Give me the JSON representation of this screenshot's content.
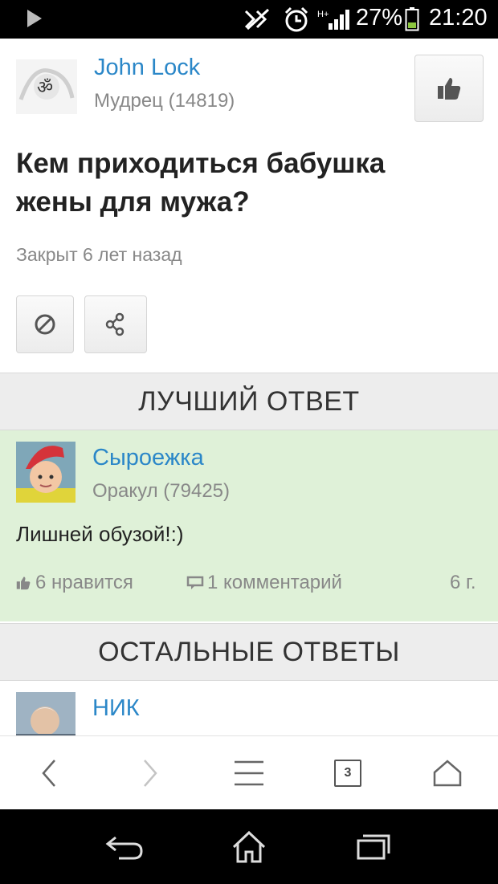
{
  "status_bar": {
    "battery_percent": "27%",
    "time": "21:20",
    "icons": [
      "play-icon",
      "mute-icon",
      "alarm-icon",
      "signal-icon",
      "battery-icon"
    ]
  },
  "question": {
    "author_name": "John Lock",
    "author_rank": "Мудрец (14819)",
    "title": "Кем приходиться бабушка жены для мужа?",
    "status": "Закрыт 6 лет назад"
  },
  "best_answer": {
    "header": "ЛУЧШИЙ ОТВЕТ",
    "author_name": "Сыроежка",
    "author_rank": "Оракул (79425)",
    "text": "Лишней обузой!:)",
    "likes": "6 нравится",
    "comments": "1 комментарий",
    "age": "6 г."
  },
  "other_answers": {
    "header": "ОСТАЛЬНЫЕ ОТВЕТЫ",
    "first_author": "НИК"
  },
  "browser_nav": {
    "tabs_count": "3"
  },
  "colors": {
    "link": "#2b87c8",
    "best_bg": "#dff1d8",
    "header_bg": "#ededed"
  }
}
